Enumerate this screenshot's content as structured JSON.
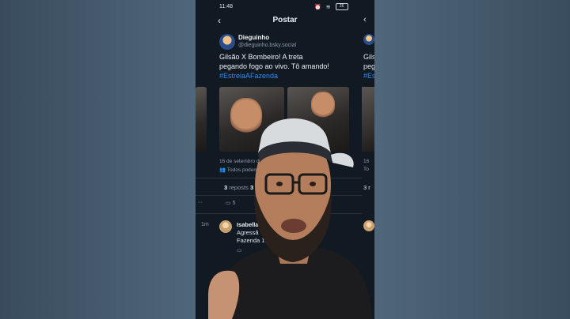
{
  "status": {
    "time": "11:48",
    "battery": "26"
  },
  "header": {
    "title": "Postar"
  },
  "post": {
    "author": "Dieguinho",
    "handle": "@dieguinho.bsky.social",
    "text_line1": "Gilsão X Bombeiro! A treta",
    "text_line2": "pegando fogo ao vivo. Tô amando!",
    "hashtag": "#EstreiaAFazenda",
    "date": "16 de setembro d",
    "audience": "Todos podem"
  },
  "stats": {
    "reposts_count": "3",
    "reposts_label": "reposts",
    "likes_count": "3"
  },
  "actions": {
    "replies_count": "5"
  },
  "reply": {
    "time": "1m",
    "name": "Isabella",
    "text_line1": "Agressã",
    "text_line2": "Fazenda 1"
  },
  "ghost_right": {
    "line1": "Gils",
    "line2": "peg",
    "line3": "#Est",
    "date_fragment": "16",
    "audience_fragment": "To",
    "reposts_fragment": "3 r"
  },
  "colors": {
    "background": "#3e5366",
    "app_bg": "#111923",
    "accent": "#2f8bf2",
    "muted": "#8e9bab"
  }
}
